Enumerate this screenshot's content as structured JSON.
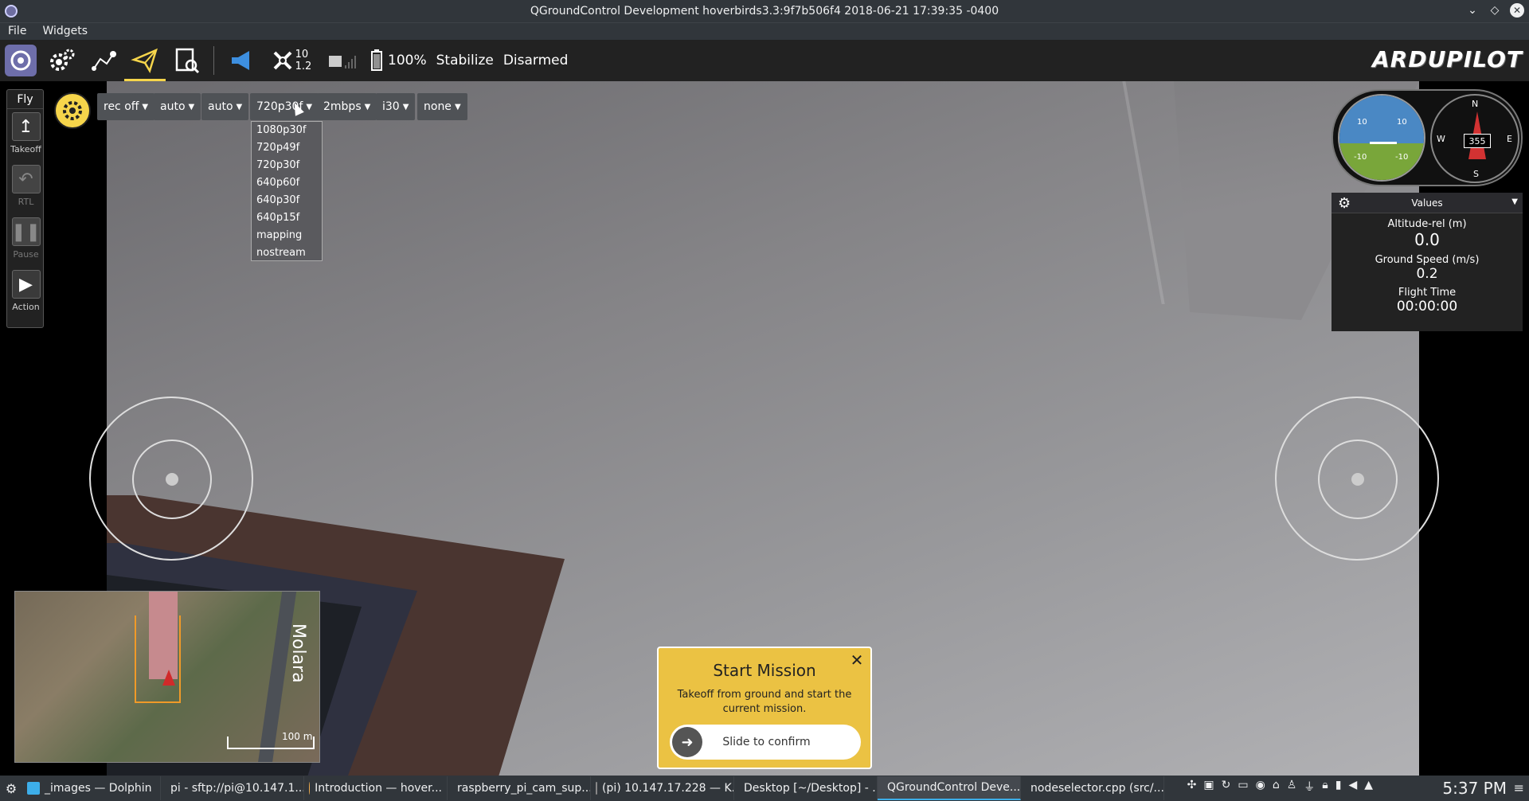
{
  "window": {
    "title": "QGroundControl Development hoverbirds3.3:9f7b506f4 2018-06-21 17:39:35 -0400"
  },
  "menubar": {
    "items": [
      "File",
      "Widgets"
    ]
  },
  "toolbar": {
    "sats_count": "10",
    "hdop": "1.2",
    "battery": "100%",
    "flight_mode": "Stabilize",
    "arm_status": "Disarmed",
    "brand": "ARDUPILOT"
  },
  "fly_panel": {
    "label": "Fly",
    "buttons": [
      {
        "label": "Takeoff",
        "icon": "↥"
      },
      {
        "label": "RTL",
        "icon": "↶"
      },
      {
        "label": "Pause",
        "icon": "❚❚"
      },
      {
        "label": "Action",
        "icon": "▶"
      }
    ]
  },
  "camera": {
    "dropdowns": [
      {
        "value": "rec off"
      },
      {
        "value": "auto"
      },
      {
        "value": "auto"
      },
      {
        "value": "720p30f"
      },
      {
        "value": "2mbps"
      },
      {
        "value": "i30"
      },
      {
        "value": "none"
      }
    ],
    "resolution_options": [
      "1080p30f",
      "720p49f",
      "720p30f",
      "640p60f",
      "640p30f",
      "640p15f",
      "mapping",
      "nostream"
    ]
  },
  "instruments": {
    "pitch_up_left": "10",
    "pitch_up_right": "10",
    "pitch_down_left": "-10",
    "pitch_down_right": "-10",
    "compass": {
      "n": "N",
      "s": "S",
      "e": "E",
      "w": "W",
      "heading": "355"
    }
  },
  "values_panel": {
    "header": "Values",
    "rows": [
      {
        "name": "Altitude-rel (m)",
        "value": "0.0"
      },
      {
        "name": "Ground Speed (m/s)",
        "value": "0.2"
      },
      {
        "name": "Flight Time",
        "value": "00:00:00"
      }
    ]
  },
  "minimap": {
    "label": "Molara",
    "scale": "100 m"
  },
  "mission": {
    "title": "Start Mission",
    "description": "Takeoff from ground and start the current mission.",
    "slider_label": "Slide to confirm"
  },
  "taskbar": {
    "tasks": [
      {
        "label": "_images — Dolphin",
        "color": "#3daee9"
      },
      {
        "label": "pi - sftp://pi@10.147.1...",
        "color": "#d9534f"
      },
      {
        "label": "Introduction — hover...",
        "color": "#f0ad4e"
      },
      {
        "label": "raspberry_pi_cam_sup...",
        "color": "#dddddd"
      },
      {
        "label": "(pi) 10.147.17.228 — K...",
        "color": "#444444"
      },
      {
        "label": "Desktop [~/Desktop] - ...",
        "color": "#a0c040"
      },
      {
        "label": "QGroundControl Deve...",
        "color": "#6e6eaa"
      },
      {
        "label": "nodeselector.cpp (src/...",
        "color": "#41cd52"
      }
    ],
    "clock": "5:37 PM"
  }
}
